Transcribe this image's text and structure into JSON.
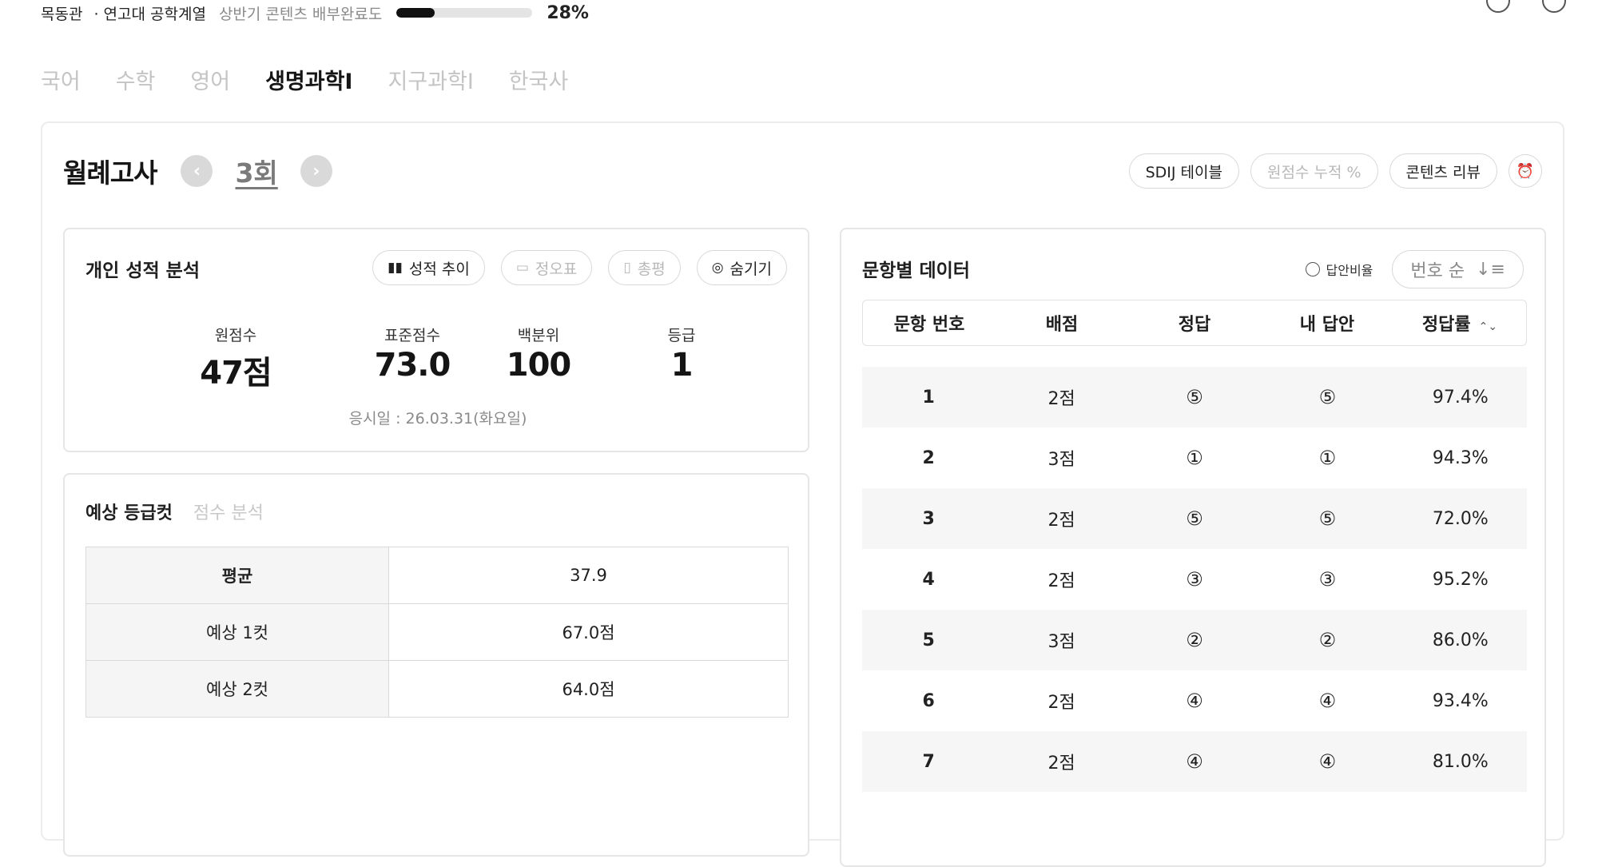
{
  "topbar": {
    "campus": "목동관",
    "affiliation": "· 연고대 공학계열",
    "progress_label": "상반기 콘텐츠 배부완료도",
    "progress_value": 28,
    "progress_text": "28%"
  },
  "tabs": [
    {
      "label": "국어",
      "active": false
    },
    {
      "label": "수학",
      "active": false
    },
    {
      "label": "영어",
      "active": false
    },
    {
      "label": "생명과학I",
      "active": true
    },
    {
      "label": "지구과학I",
      "active": false
    },
    {
      "label": "한국사",
      "active": false
    }
  ],
  "exam": {
    "title": "월례고사",
    "round": "3회",
    "actions": {
      "sdij_table": "SDIJ 테이블",
      "cumulative": "원점수 누적 %",
      "content_review": "콘텐츠 리뷰"
    }
  },
  "personal": {
    "title": "개인 성적 분석",
    "buttons": {
      "trend": "성적 추이",
      "answer_sheet": "정오표",
      "review": "총평",
      "hide": "숨기기"
    },
    "stats": [
      {
        "label": "원점수",
        "value": "47점"
      },
      {
        "label": "표준점수",
        "value": "73.0"
      },
      {
        "label": "백분위",
        "value": "100"
      },
      {
        "label": "등급",
        "value": "1"
      }
    ],
    "date_label": "응시일 : ",
    "date_value": "26.03.31(화요일)"
  },
  "cut": {
    "tabs": [
      "예상 등급컷",
      "점수 분석"
    ],
    "rows": [
      {
        "key": "평균",
        "value": "37.9"
      },
      {
        "key": "예상 1컷",
        "value": "67.0점"
      },
      {
        "key": "예상 2컷",
        "value": "64.0점"
      }
    ]
  },
  "items": {
    "title": "문항별 데이터",
    "ratio_label": "답안비율",
    "sort_label": "번호 순",
    "headers": [
      "문항 번호",
      "배점",
      "정답",
      "내 답안",
      "정답률"
    ],
    "rows": [
      {
        "no": "1",
        "points": "2점",
        "answer": "⑤",
        "mine": "⑤",
        "rate": "97.4%"
      },
      {
        "no": "2",
        "points": "3점",
        "answer": "①",
        "mine": "①",
        "rate": "94.3%"
      },
      {
        "no": "3",
        "points": "2점",
        "answer": "⑤",
        "mine": "⑤",
        "rate": "72.0%"
      },
      {
        "no": "4",
        "points": "2점",
        "answer": "③",
        "mine": "③",
        "rate": "95.2%"
      },
      {
        "no": "5",
        "points": "3점",
        "answer": "②",
        "mine": "②",
        "rate": "86.0%"
      },
      {
        "no": "6",
        "points": "2점",
        "answer": "④",
        "mine": "④",
        "rate": "93.4%"
      },
      {
        "no": "7",
        "points": "2점",
        "answer": "④",
        "mine": "④",
        "rate": "81.0%"
      }
    ]
  }
}
